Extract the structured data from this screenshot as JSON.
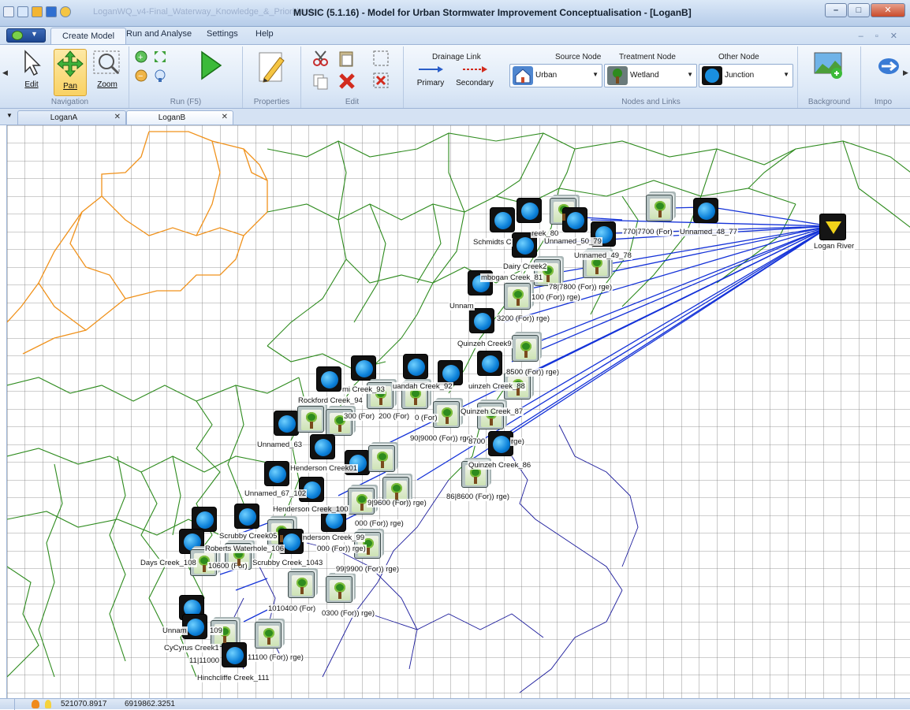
{
  "window": {
    "title": "MUSIC (5.1.16) - Model for Urban Stormwater Improvement Conceptualisation - [LoganB]",
    "file_name": "LoganWQ_v4-Final_Waterway_Knowledge_&_Prioritisation",
    "minimize": "–",
    "maximize": "□",
    "close": "✕"
  },
  "menu": {
    "tabs": [
      "Create Model",
      "Run and Analyse",
      "Settings",
      "Help"
    ],
    "active_tab": "Create Model"
  },
  "ribbon": {
    "navigation": {
      "label": "Navigation",
      "edit": "Edit",
      "pan": "Pan",
      "zoom": "Zoom"
    },
    "run": {
      "label": "Run (F5)"
    },
    "properties": {
      "label": "Properties"
    },
    "edit_group": {
      "label": "Edit"
    },
    "drainage": {
      "title": "Drainage Link",
      "primary": "Primary",
      "secondary": "Secondary"
    },
    "nodes": {
      "label": "Nodes and Links",
      "source_title": "Source Node",
      "source_value": "Urban",
      "treatment_title": "Treatment Node",
      "treatment_value": "Wetland",
      "other_title": "Other Node",
      "other_value": "Junction"
    },
    "background": {
      "label": "Background"
    },
    "import": {
      "label": "Impo"
    }
  },
  "doc_tabs": [
    {
      "name": "LoganA",
      "close": "✕"
    },
    {
      "name": "LoganB",
      "close": "✕"
    }
  ],
  "canvas": {
    "outlet_label": "Logan River",
    "labels": [
      "Schmidts C",
      "reek_80",
      "Unnamed_50_79",
      "770|7700 (For)",
      "Unnamed_48_77",
      "Unnamed_49_78",
      "Dairy Creek2",
      "mbogan Creek_81",
      "78|7800 (For)) rge)",
      "100 (For)) rge)",
      "Unnam",
      "3200 (For)) rge)",
      "Quinzeh Creek9",
      "8500 (For)) rge)",
      "uinzeh Creek_88",
      "Quinzeh Creek_87",
      "90|9000 (For)) rge)",
      "8700",
      "rge)",
      "Quinzeh Creek_86",
      "86|8600 (For)) rge)",
      "mi Creek_93",
      "uandah Creek_92",
      "Rockford Creek_94",
      "300 (For)",
      "200 (For)",
      "0 (For)",
      "Unnamed_63",
      "Henderson Creek01",
      "Unnamed_67_102",
      "Henderson Creek_100",
      "9|9600 (For)) rge)",
      "000 (For)) rge)",
      "Scrubby Creek05",
      "Roberts Waterhole_106",
      "nderson Creek_99",
      "000 (For)) rge)",
      "Days Creek_108",
      "10600 (For)",
      "Scrubby Creek_1043",
      "99|9900 (For)) rge)",
      "1010400 (For)",
      "0300 (For)) rge)",
      "Unnam",
      "109",
      "CyCyrus Creek1",
      "11|11000",
      "11100 (For)) rge)",
      "Hinchcliffe Creek_111"
    ]
  },
  "status": {
    "x": "521070.8917",
    "y": "6919862.3251"
  }
}
